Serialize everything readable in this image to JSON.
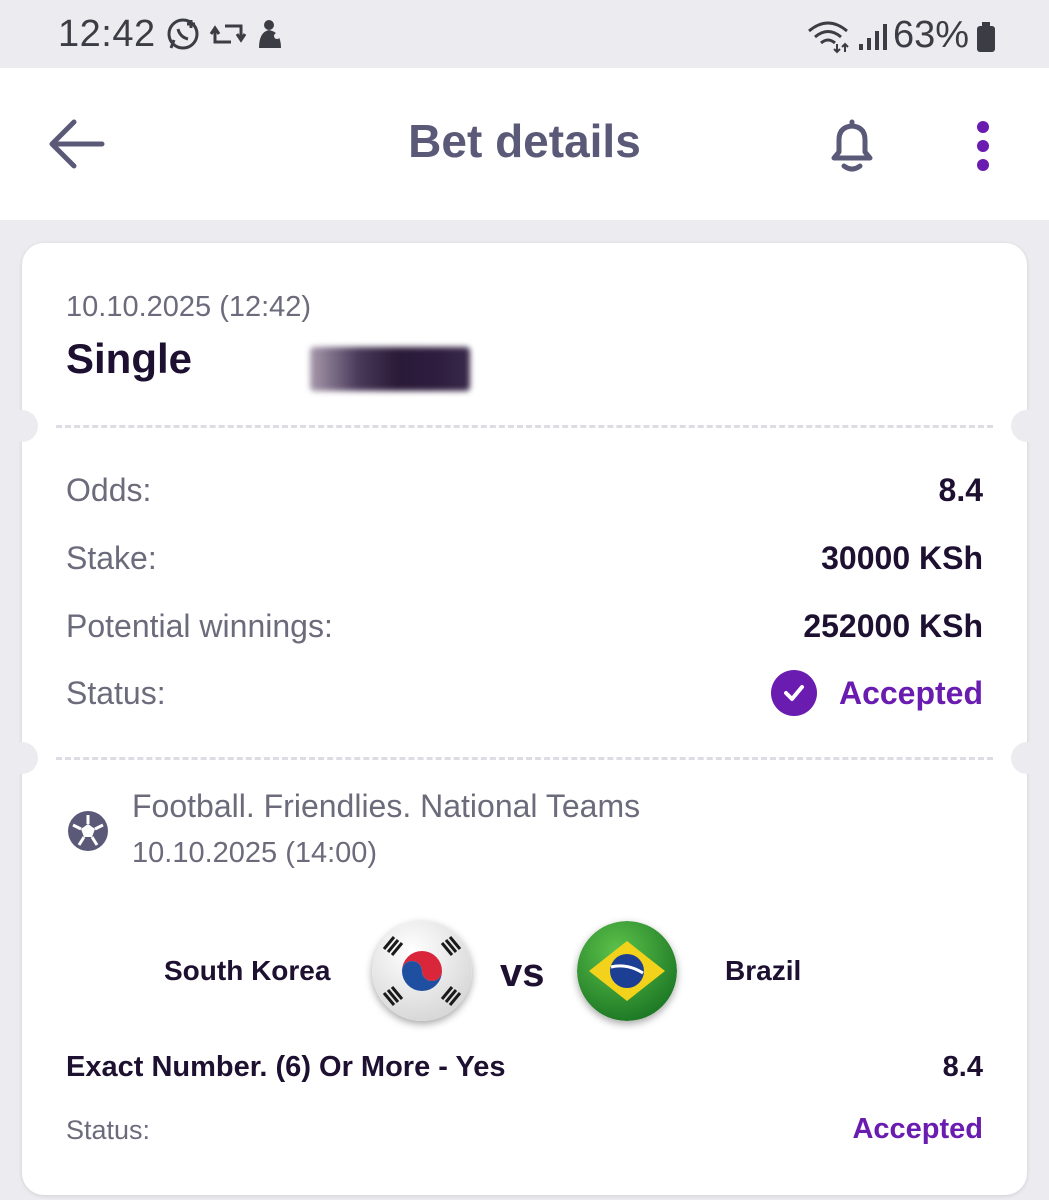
{
  "status_bar": {
    "time": "12:42",
    "battery": "63%",
    "icons": [
      "whatsapp-icon",
      "sync-icon",
      "notification-icon",
      "wifi-icon",
      "signal-icon",
      "battery-icon"
    ]
  },
  "header": {
    "title": "Bet details",
    "icons": [
      "back-arrow-icon",
      "bell-icon",
      "more-vertical-icon"
    ]
  },
  "bet": {
    "date": "10.10.2025 (12:42)",
    "type": "Single",
    "summary": [
      {
        "label": "Odds:",
        "value": "8.4"
      },
      {
        "label": "Stake:",
        "value": "30000 KSh"
      },
      {
        "label": "Potential winnings:",
        "value": "252000 KSh"
      }
    ],
    "status_label": "Status:",
    "status_value": "Accepted"
  },
  "event": {
    "league": "Football. Friendlies. National Teams",
    "date": "10.10.2025 (14:00)",
    "home_team": "South Korea",
    "away_team": "Brazil",
    "vs": "vs",
    "selection": "Exact Number. (6) Or More - Yes",
    "selection_odds": "8.4",
    "status_label": "Status:",
    "status_value": "Accepted"
  },
  "colors": {
    "accent": "#6a1bb0",
    "text_dark": "#1d1030",
    "text_muted": "#6b6b7b",
    "background": "#ececf0"
  }
}
